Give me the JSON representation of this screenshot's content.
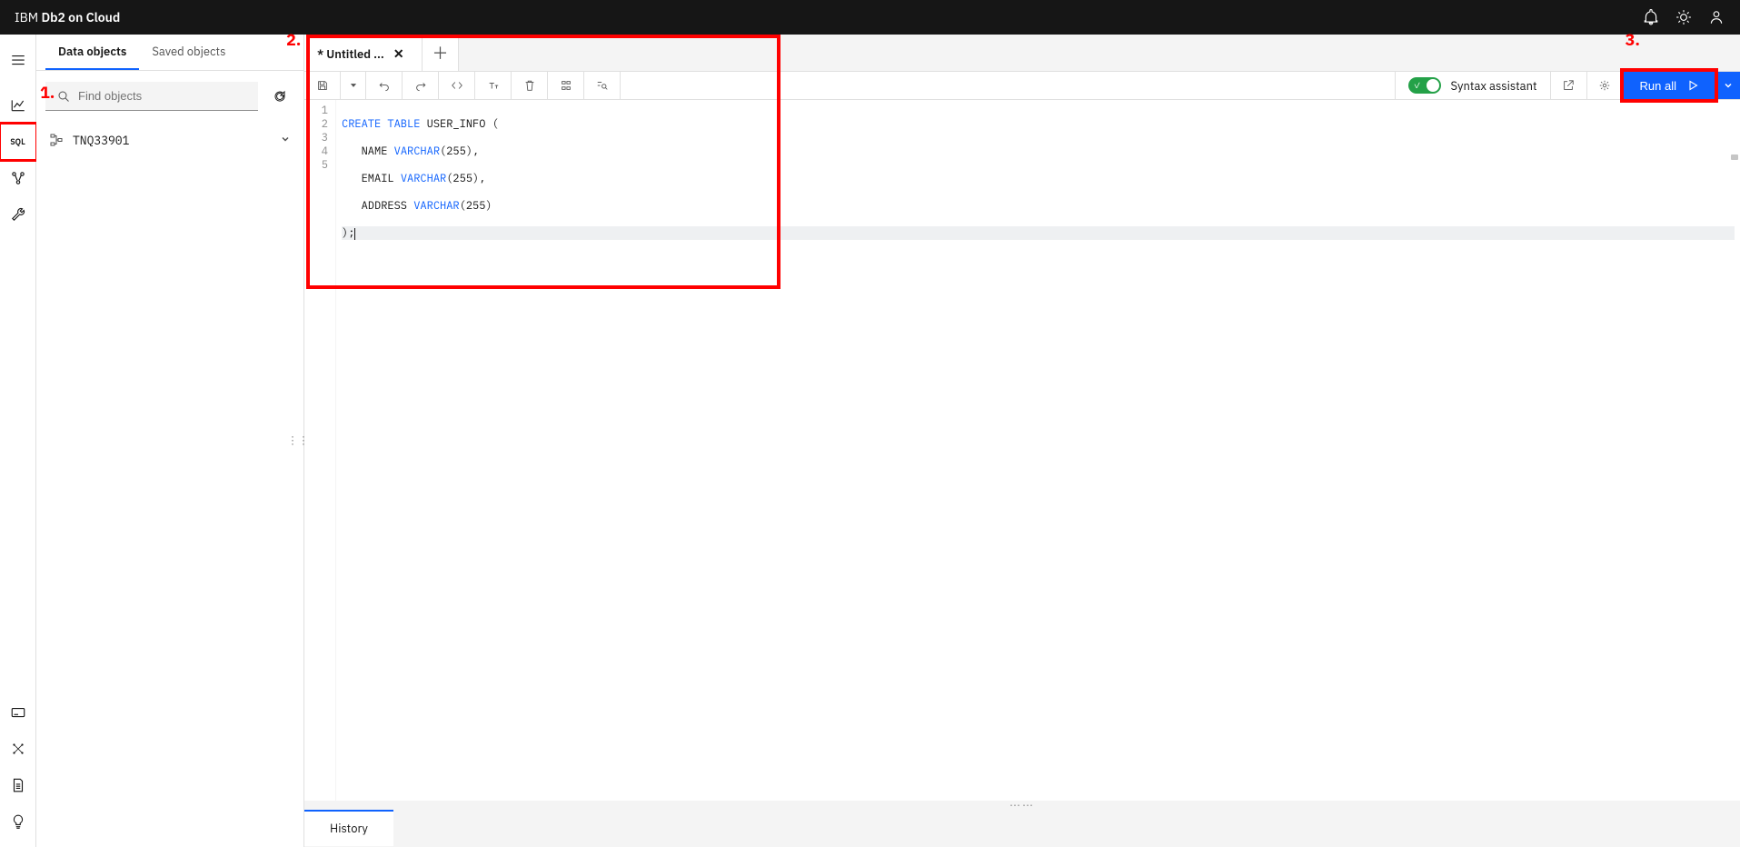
{
  "header": {
    "brand_prefix": "IBM",
    "brand_name": "Db2 on Cloud"
  },
  "annotations": {
    "one": "1.",
    "two": "2.",
    "three": "3."
  },
  "sidebar": {
    "tab_data": "Data objects",
    "tab_saved": "Saved objects",
    "search_placeholder": "Find objects",
    "tree_item": "TNQ33901"
  },
  "editor": {
    "tab_title": "* Untitled ...",
    "syntax_assistant": "Syntax assistant",
    "run_all": "Run all",
    "code": {
      "l1_kw1": "CREATE",
      "l1_kw2": "TABLE",
      "l1_rest": " USER_INFO (",
      "l2_name": "NAME",
      "l2_type": "VARCHAR",
      "l2_args": "(255),",
      "l3_name": "EMAIL",
      "l3_type": "VARCHAR",
      "l3_args": "(255),",
      "l4_name": "ADDRESS",
      "l4_type": "VARCHAR",
      "l4_args": "(255)",
      "l5": ");"
    },
    "line_numbers": [
      "1",
      "2",
      "3",
      "4",
      "5"
    ]
  },
  "bottom": {
    "history": "History"
  }
}
